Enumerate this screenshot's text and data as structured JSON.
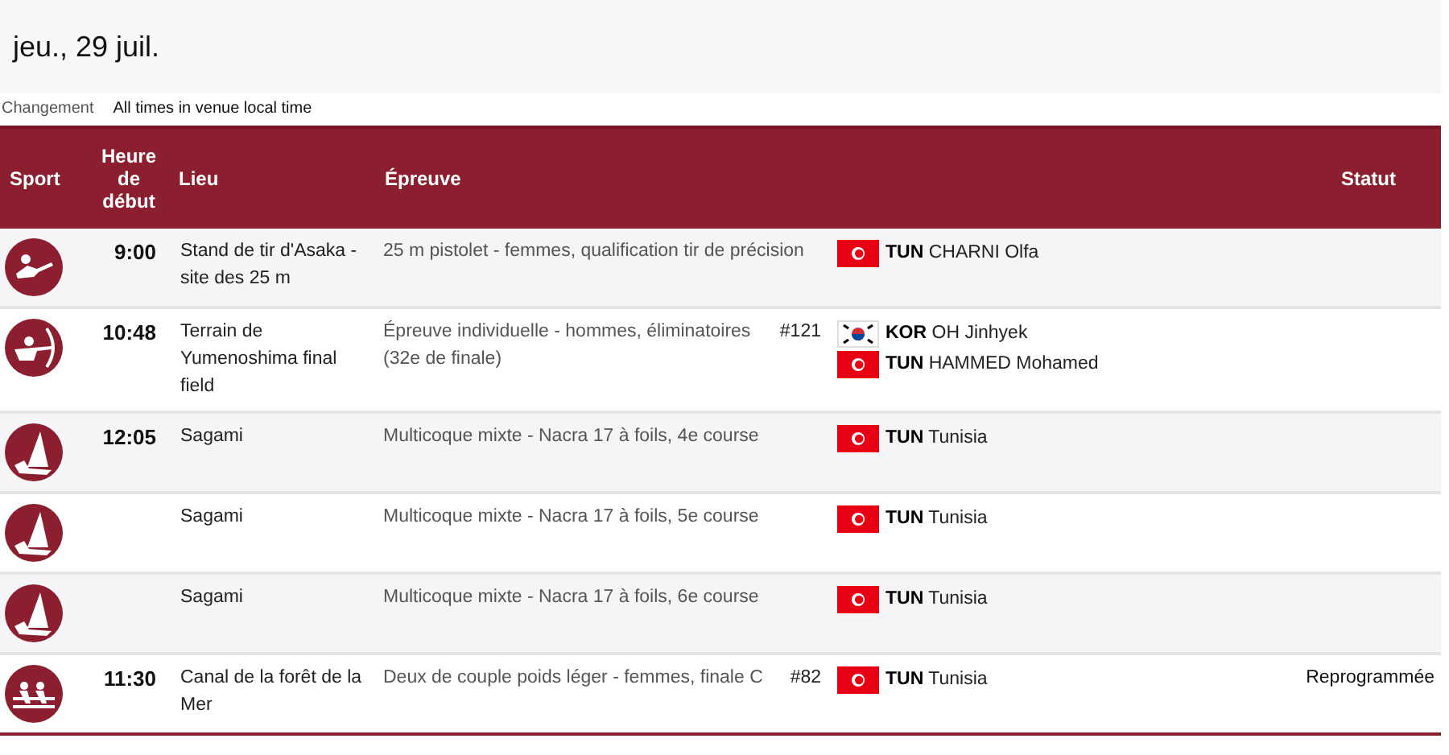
{
  "date": "jeu., 29 juil.",
  "legend": {
    "change_label": "Changement",
    "timezone_note": "All times in venue local time"
  },
  "table": {
    "columns": [
      "Sport",
      "Heure de début",
      "Lieu",
      "Épreuve",
      "Statut"
    ],
    "rows": [
      {
        "kind": "shooting",
        "time": "9:00",
        "venue": "Stand de tir d'Asaka - site des 25 m",
        "event": "25 m pistolet - femmes, qualification tir de précision",
        "athletes": [
          {
            "kind": "tunisia",
            "code": "TUN",
            "name": "CHARNI Olfa"
          }
        ]
      },
      {
        "kind": "archery",
        "time": "10:48",
        "venue": "Terrain de Yumenoshima final field",
        "event": "Épreuve individuelle - hommes, éliminatoires (32e de finale)",
        "event_number": "#121",
        "athletes": [
          {
            "kind": "korea",
            "code": "KOR",
            "name": "OH Jinhyek"
          },
          {
            "kind": "tunisia",
            "code": "TUN",
            "name": "HAMMED Mohamed"
          }
        ]
      },
      {
        "kind": "sailing",
        "time": "12:05",
        "venue": "Sagami",
        "event": "Multicoque mixte - Nacra 17 à foils, 4e course",
        "athletes": [
          {
            "kind": "tunisia",
            "code": "TUN",
            "name": "Tunisia"
          }
        ]
      },
      {
        "kind": "sailing",
        "venue": "Sagami",
        "event": "Multicoque mixte - Nacra 17 à foils, 5e course",
        "athletes": [
          {
            "kind": "tunisia",
            "code": "TUN",
            "name": "Tunisia"
          }
        ]
      },
      {
        "kind": "sailing",
        "venue": "Sagami",
        "event": "Multicoque mixte - Nacra 17 à foils, 6e course",
        "athletes": [
          {
            "kind": "tunisia",
            "code": "TUN",
            "name": "Tunisia"
          }
        ]
      },
      {
        "kind": "rowing",
        "time": "11:30",
        "venue": "Canal de la forêt de la Mer",
        "event": "Deux de couple poids léger - femmes, finale C",
        "event_number": "#82",
        "athletes": [
          {
            "kind": "tunisia",
            "code": "TUN",
            "name": "Tunisia"
          }
        ],
        "status": "Reprogrammée"
      }
    ]
  }
}
